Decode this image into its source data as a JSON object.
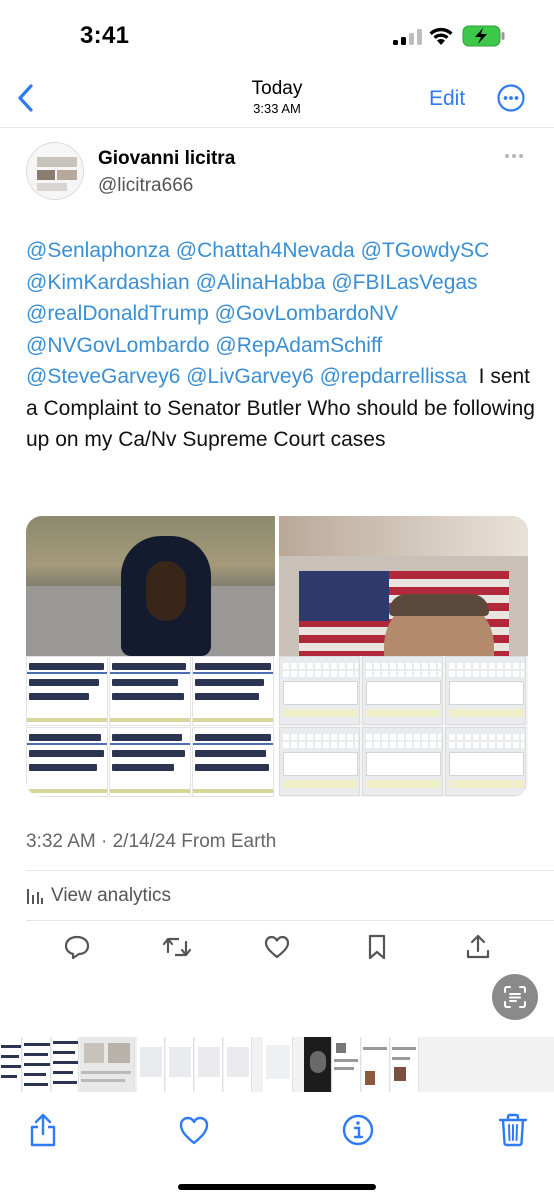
{
  "status_bar": {
    "time": "3:41",
    "icons": [
      "cellular-signal-icon",
      "wifi-icon",
      "battery-charging-icon"
    ]
  },
  "nav": {
    "back_icon": "chevron-left-icon",
    "title": "Today",
    "subtitle": "3:33 AM",
    "edit_label": "Edit",
    "more_icon": "ellipsis-circle-icon"
  },
  "tweet": {
    "display_name": "Giovanni licitra",
    "handle": "@licitra666",
    "mentions": [
      "@Senlaphonza",
      "@Chattah4Nevada",
      "@TGowdySC",
      "@KimKardashian",
      "@AlinaHabba",
      "@FBILasVegas",
      "@realDonaldTrump",
      "@GovLombardoNV",
      "@NVGovLombardo",
      "@RepAdamSchiff",
      "@SteveGarvey6",
      "@LivGarvey6",
      "@repdarrellissa"
    ],
    "body_text": "I sent a Complaint to Senator Butler Who should be following up on my Ca/Nv Supreme Court cases",
    "timestamp": "3:32 AM · 2/14/24 From Earth",
    "analytics_label": "View analytics",
    "action_icons": [
      "reply-icon",
      "retweet-icon",
      "like-icon",
      "bookmark-icon",
      "share-icon"
    ]
  },
  "colors": {
    "accent": "#2f7bf5",
    "mention": "#3a8fd4",
    "secondary_text": "#666666"
  },
  "toolbar": {
    "icons": [
      "share-icon",
      "favorite-icon",
      "info-icon",
      "delete-icon"
    ]
  }
}
